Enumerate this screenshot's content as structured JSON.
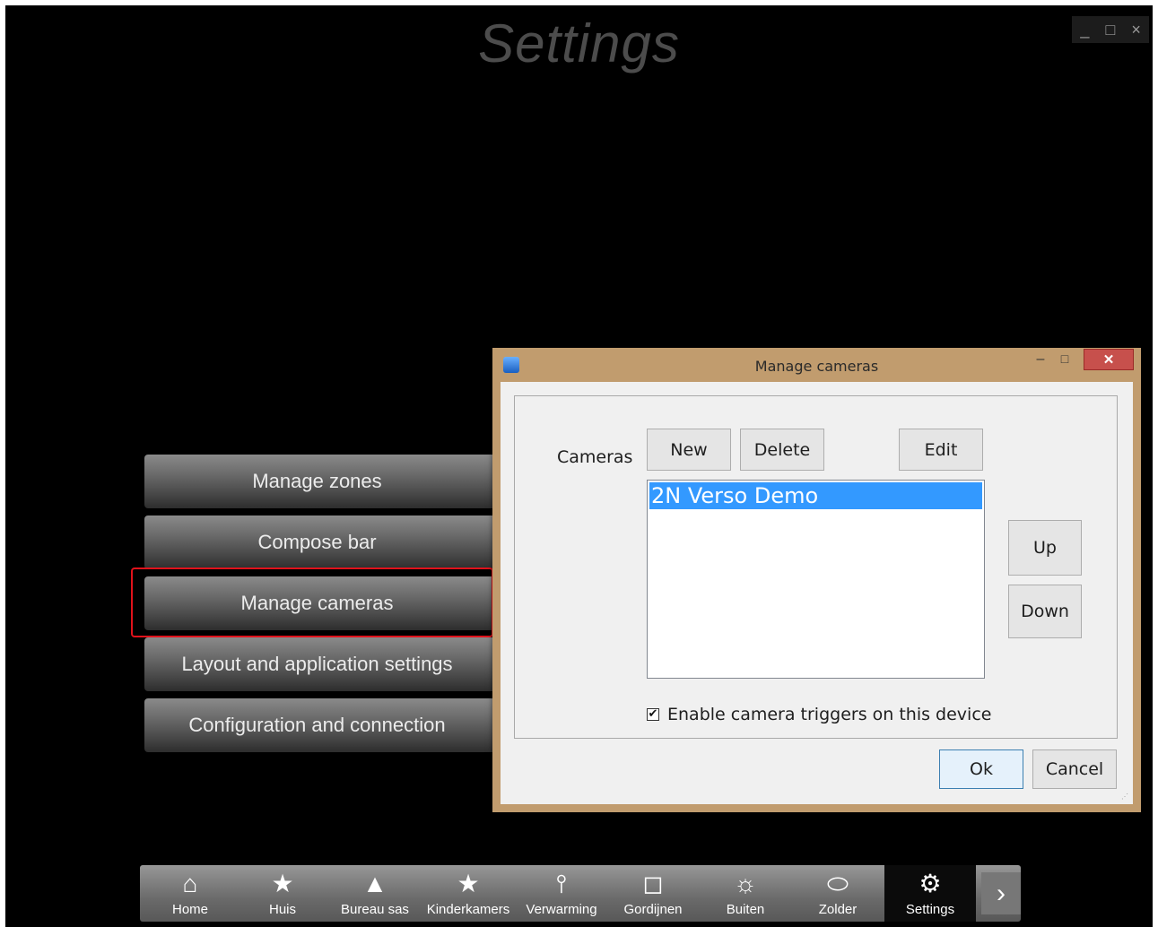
{
  "app": {
    "title": "Settings",
    "window_controls": {
      "minimize": "_",
      "maximize": "□",
      "close": "×"
    }
  },
  "menu": {
    "items": [
      {
        "label": "Manage zones"
      },
      {
        "label": "Compose bar"
      },
      {
        "label": "Manage cameras",
        "highlighted": true
      },
      {
        "label": "Layout and application settings"
      },
      {
        "label": "Configuration and connection"
      }
    ]
  },
  "dialog": {
    "title": "Manage cameras",
    "controls": {
      "minimize": "–",
      "maximize": "□",
      "close": "✕"
    },
    "cameras_label": "Cameras",
    "buttons": {
      "new": "New",
      "delete": "Delete",
      "edit": "Edit",
      "up": "Up",
      "down": "Down",
      "ok": "Ok",
      "cancel": "Cancel"
    },
    "camera_list": [
      {
        "name": "2N Verso Demo",
        "selected": true
      }
    ],
    "enable_triggers": {
      "label": "Enable camera triggers on this device",
      "checked": true,
      "mark": "✔"
    }
  },
  "navbar": {
    "items": [
      {
        "label": "Home",
        "icon": "home-icon",
        "glyph": "⌂"
      },
      {
        "label": "Huis",
        "icon": "star-icon",
        "glyph": "★"
      },
      {
        "label": "Bureau sas",
        "icon": "person-icon",
        "glyph": "▲"
      },
      {
        "label": "Kinderkamers",
        "icon": "star-icon",
        "glyph": "★"
      },
      {
        "label": "Verwarming",
        "icon": "thermometer-icon",
        "glyph": "⫯"
      },
      {
        "label": "Gordijnen",
        "icon": "curtain-icon",
        "glyph": "◻"
      },
      {
        "label": "Buiten",
        "icon": "sun-icon",
        "glyph": "☼"
      },
      {
        "label": "Zolder",
        "icon": "ring-icon",
        "glyph": "⬭"
      },
      {
        "label": "Settings",
        "icon": "gear-icon",
        "glyph": "⚙",
        "active": true
      }
    ],
    "next_glyph": "›"
  }
}
